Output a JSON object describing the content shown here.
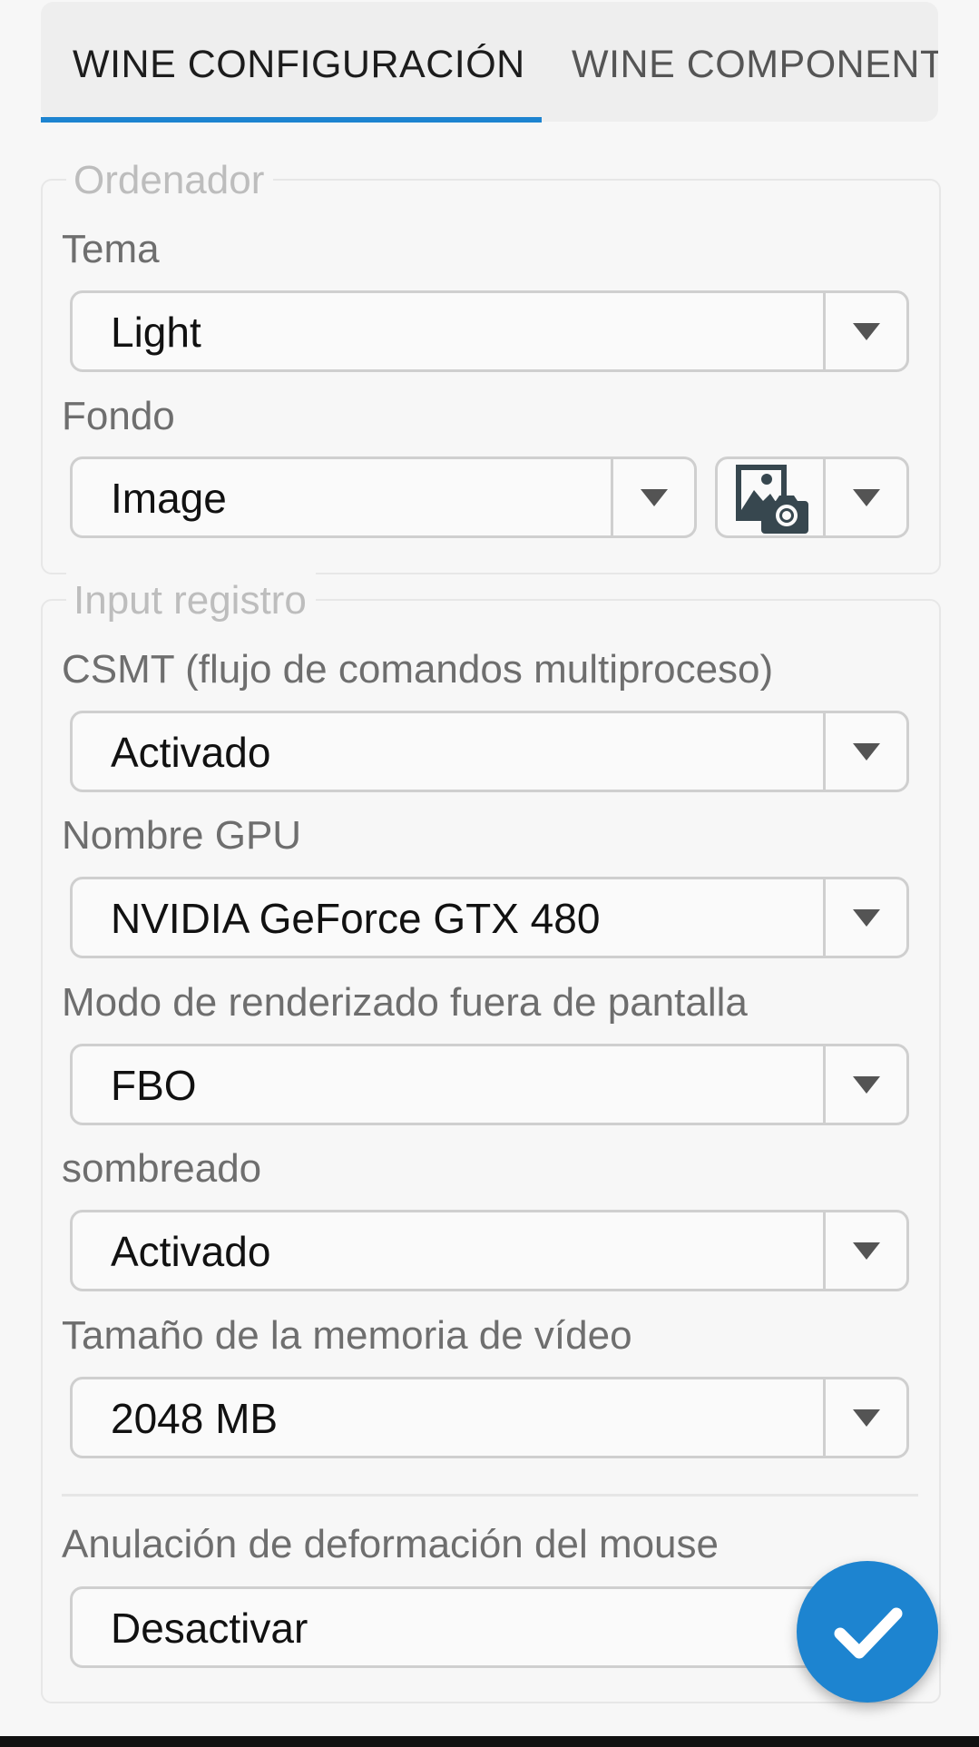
{
  "tabs": [
    {
      "label": "WINE CONFIGURACIÓN",
      "active": true
    },
    {
      "label": "WINE COMPONENT",
      "active": false
    }
  ],
  "accent_color": "#1d84d0",
  "desktop_group": {
    "legend": "Ordenador",
    "theme": {
      "label": "Tema",
      "value": "Light"
    },
    "background": {
      "label": "Fondo",
      "value": "Image",
      "picker_icon": "image-camera-icon"
    }
  },
  "registry_group": {
    "legend": "Input registro",
    "csmt": {
      "label": "CSMT (flujo de comandos multiproceso)",
      "value": "Activado"
    },
    "gpu_name": {
      "label": "Nombre GPU",
      "value": "NVIDIA GeForce GTX 480"
    },
    "offscreen_mode": {
      "label": "Modo de renderizado fuera de pantalla",
      "value": "FBO"
    },
    "shading": {
      "label": "sombreado",
      "value": "Activado"
    },
    "video_memory": {
      "label": "Tamaño de la memoria de vídeo",
      "value": "2048 MB"
    },
    "mouse_warp": {
      "label": "Anulación de deformación del mouse",
      "value": "Desactivar"
    }
  },
  "fab": {
    "icon": "checkmark-icon"
  }
}
